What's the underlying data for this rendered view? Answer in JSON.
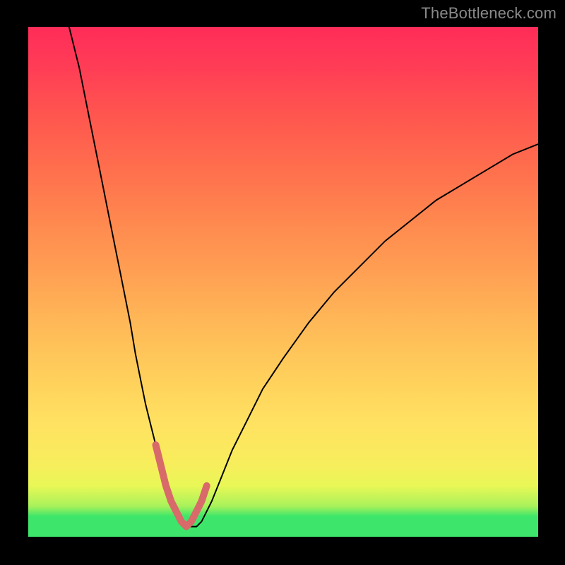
{
  "watermark": "TheBottleneck.com",
  "chart_data": {
    "type": "line",
    "title": "",
    "xlabel": "",
    "ylabel": "",
    "xlim": [
      0,
      100
    ],
    "ylim": [
      0,
      100
    ],
    "grid": false,
    "legend": false,
    "gradient_stops": [
      {
        "pos": 0,
        "color": "#3de66a"
      },
      {
        "pos": 4,
        "color": "#3de66a"
      },
      {
        "pos": 6,
        "color": "#a8f25a"
      },
      {
        "pos": 10,
        "color": "#e9f756"
      },
      {
        "pos": 14,
        "color": "#f7ee5c"
      },
      {
        "pos": 22,
        "color": "#ffe261"
      },
      {
        "pos": 32,
        "color": "#ffce5b"
      },
      {
        "pos": 42,
        "color": "#ffb857"
      },
      {
        "pos": 52,
        "color": "#ff9f53"
      },
      {
        "pos": 62,
        "color": "#ff884f"
      },
      {
        "pos": 72,
        "color": "#ff6f4d"
      },
      {
        "pos": 83,
        "color": "#ff554f"
      },
      {
        "pos": 92,
        "color": "#ff3d56"
      },
      {
        "pos": 100,
        "color": "#ff2c59"
      }
    ],
    "series": [
      {
        "name": "main-curve",
        "stroke": "#000000",
        "stroke_width": 2,
        "x": [
          8,
          10,
          12,
          14,
          16,
          18,
          20,
          21,
          22,
          23,
          24,
          25,
          26,
          27,
          28,
          29,
          30,
          31,
          32,
          33,
          34,
          35,
          36,
          38,
          40,
          43,
          46,
          50,
          55,
          60,
          65,
          70,
          75,
          80,
          85,
          90,
          95,
          100
        ],
        "y": [
          100,
          92,
          82,
          72,
          62,
          52,
          42,
          36,
          31,
          26,
          22,
          18,
          14,
          10,
          7,
          5,
          3,
          2,
          2,
          2,
          3,
          5,
          7,
          12,
          17,
          23,
          29,
          35,
          42,
          48,
          53,
          58,
          62,
          66,
          69,
          72,
          75,
          77
        ]
      },
      {
        "name": "valley-highlight",
        "stroke": "#d86a6a",
        "stroke_width": 10,
        "x": [
          25,
          26,
          27,
          28,
          29,
          30,
          31,
          32,
          33,
          34,
          35
        ],
        "y": [
          18,
          14,
          10,
          7,
          5,
          3,
          2,
          3,
          5,
          7,
          10
        ]
      }
    ],
    "annotations": []
  }
}
